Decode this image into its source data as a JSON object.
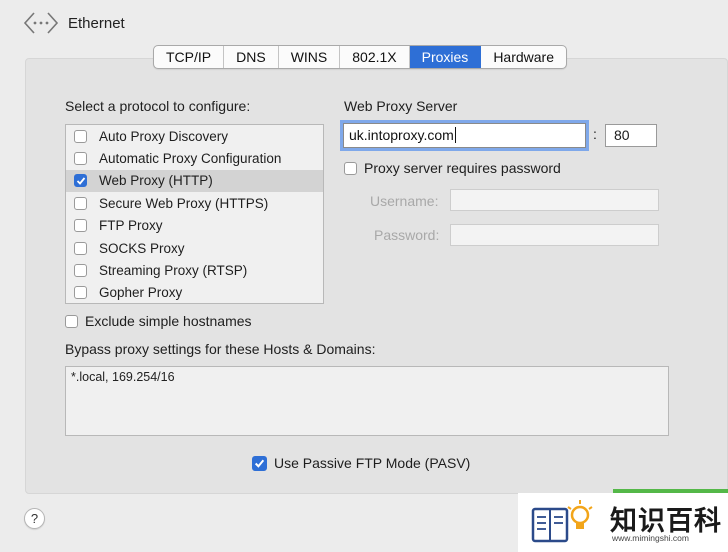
{
  "header": {
    "title": "Ethernet",
    "icon": "network-arrows-icon"
  },
  "tabs": [
    {
      "label": "TCP/IP",
      "active": false
    },
    {
      "label": "DNS",
      "active": false
    },
    {
      "label": "WINS",
      "active": false
    },
    {
      "label": "802.1X",
      "active": false
    },
    {
      "label": "Proxies",
      "active": true
    },
    {
      "label": "Hardware",
      "active": false
    }
  ],
  "protocols": {
    "heading": "Select a protocol to configure:",
    "items": [
      {
        "label": "Auto Proxy Discovery",
        "checked": false
      },
      {
        "label": "Automatic Proxy Configuration",
        "checked": false
      },
      {
        "label": "Web Proxy (HTTP)",
        "checked": true
      },
      {
        "label": "Secure Web Proxy (HTTPS)",
        "checked": false
      },
      {
        "label": "FTP Proxy",
        "checked": false
      },
      {
        "label": "SOCKS Proxy",
        "checked": false
      },
      {
        "label": "Streaming Proxy (RTSP)",
        "checked": false
      },
      {
        "label": "Gopher Proxy",
        "checked": false
      }
    ]
  },
  "exclude_simple": {
    "label": "Exclude simple hostnames",
    "checked": false
  },
  "web_proxy": {
    "heading": "Web Proxy Server",
    "server": "uk.intoproxy.com",
    "colon": ":",
    "port": "80",
    "requires_password": {
      "label": "Proxy server requires password",
      "checked": false
    },
    "username_label": "Username:",
    "password_label": "Password:"
  },
  "bypass": {
    "label": "Bypass proxy settings for these Hosts & Domains:",
    "value": "*.local, 169.254/16"
  },
  "passive_ftp": {
    "label": "Use Passive FTP Mode (PASV)",
    "checked": true
  },
  "help": {
    "label": "?"
  },
  "watermark": {
    "title": "知识百科",
    "url": "www.mimingshi.com"
  },
  "colors": {
    "accent": "#2e6fd6",
    "focus_ring": "#7fa8ea",
    "watermark_green": "#54b848"
  }
}
